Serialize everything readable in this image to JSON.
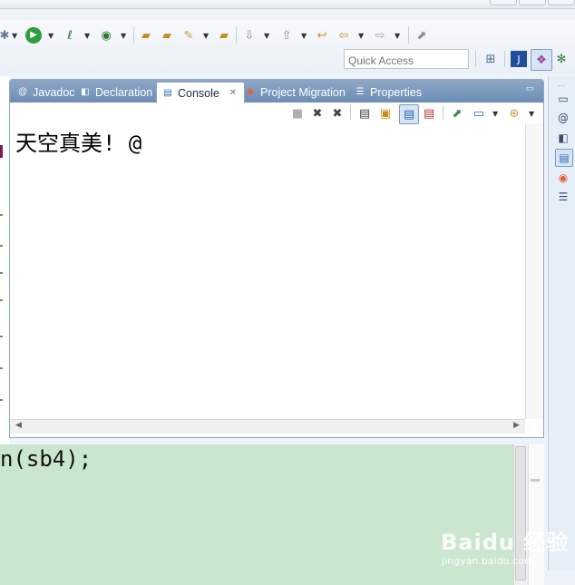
{
  "quick_access": {
    "placeholder": "Quick Access"
  },
  "tabs": [
    {
      "label": "Javadoc",
      "icon": "javadoc-icon",
      "active": false
    },
    {
      "label": "Declaration",
      "icon": "declaration-icon",
      "active": false
    },
    {
      "label": "Console",
      "icon": "console-icon",
      "active": true
    },
    {
      "label": "Project Migration",
      "icon": "migration-icon",
      "active": false
    },
    {
      "label": "Properties",
      "icon": "properties-icon",
      "active": false
    }
  ],
  "console": {
    "output": "天空真美! @",
    "toolbar_icons": [
      "terminate-icon",
      "remove-launch-icon",
      "remove-all-launches-icon",
      "clear-console-icon",
      "scroll-lock-icon",
      "show-on-output-icon",
      "show-on-error-icon",
      "pin-console-icon",
      "display-selected-console-icon",
      "open-console-icon"
    ]
  },
  "editor": {
    "code_line": "n(sb4);"
  },
  "watermark": {
    "brand": "Baidu 经验",
    "url": "jingyan.baidu.com"
  },
  "colors": {
    "tab_bar": "#7a98be",
    "code_bg": "#cbe6cf",
    "accent": "#2a6ab7"
  }
}
